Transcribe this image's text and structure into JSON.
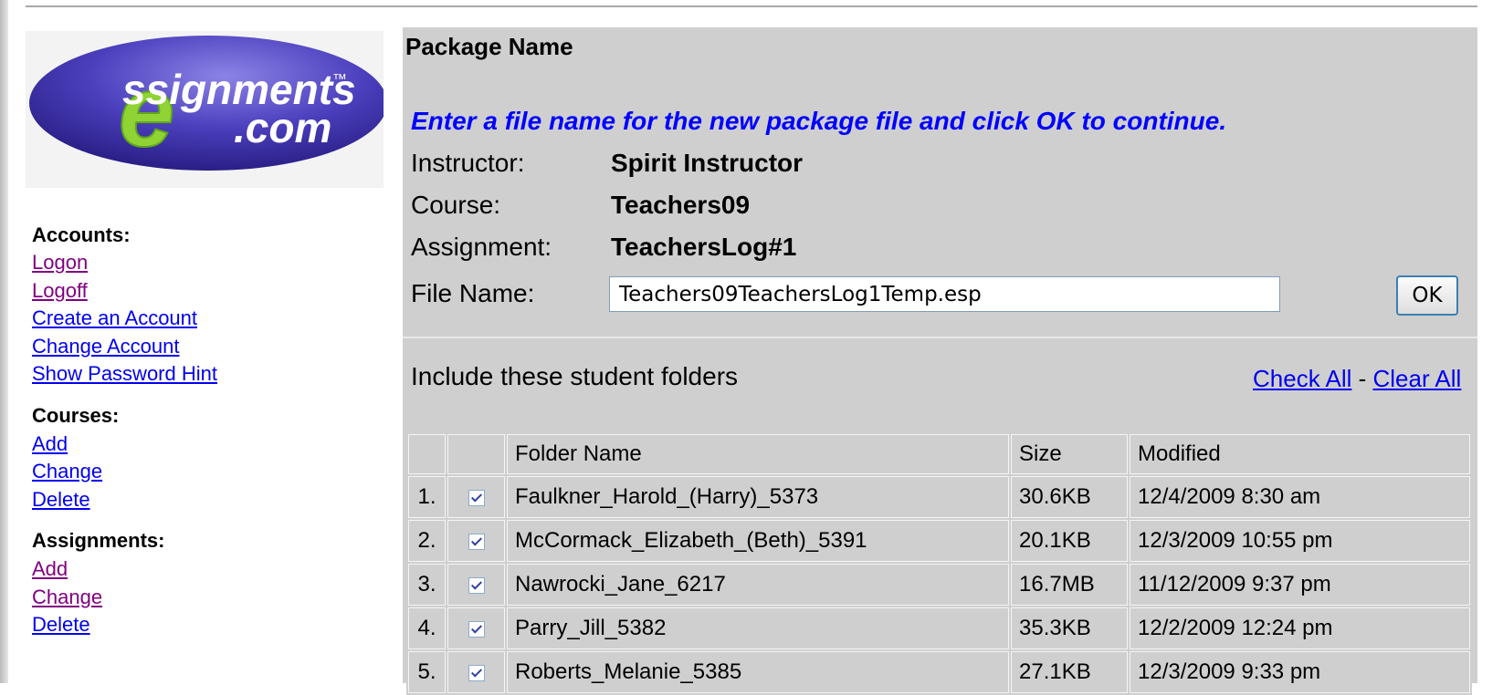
{
  "logo": {
    "text_main": "ssignments",
    "text_sub": ".com",
    "tm": "™"
  },
  "sidebar": {
    "accounts_heading": "Accounts:",
    "accounts_links": [
      "Logon",
      "Logoff",
      "Create an Account",
      "Change Account",
      "Show Password Hint"
    ],
    "courses_heading": "Courses:",
    "courses_links": [
      "Add",
      "Change",
      "Delete"
    ],
    "assignments_heading": "Assignments:",
    "assignments_links": [
      "Add",
      "Change",
      "Delete"
    ]
  },
  "main": {
    "title": "Package Name",
    "instructions": "Enter a file name for the new package file and click OK to continue.",
    "instructor_label": "Instructor:",
    "instructor_value": "Spirit Instructor",
    "course_label": "Course:",
    "course_value": "Teachers09",
    "assignment_label": "Assignment:",
    "assignment_value": "TeachersLog#1",
    "filename_label": "File Name:",
    "filename_value": "Teachers09TeachersLog1Temp.esp",
    "ok_label": "OK",
    "include_label": "Include these student folders",
    "check_all": "Check All",
    "separator": " - ",
    "clear_all": "Clear All"
  },
  "table": {
    "headers": [
      "",
      "",
      "Folder Name",
      "Size",
      "Modified"
    ],
    "rows": [
      {
        "num": "1.",
        "checked": true,
        "name": "Faulkner_Harold_(Harry)_5373",
        "size": "30.6KB",
        "modified": "12/4/2009 8:30 am"
      },
      {
        "num": "2.",
        "checked": true,
        "name": "McCormack_Elizabeth_(Beth)_5391",
        "size": "20.1KB",
        "modified": "12/3/2009 10:55 pm"
      },
      {
        "num": "3.",
        "checked": true,
        "name": "Nawrocki_Jane_6217",
        "size": "16.7MB",
        "modified": "11/12/2009 9:37 pm"
      },
      {
        "num": "4.",
        "checked": true,
        "name": "Parry_Jill_5382",
        "size": "35.3KB",
        "modified": "12/2/2009 12:24 pm"
      },
      {
        "num": "5.",
        "checked": true,
        "name": "Roberts_Melanie_5385",
        "size": "27.1KB",
        "modified": "12/3/2009 9:33 pm"
      }
    ]
  }
}
